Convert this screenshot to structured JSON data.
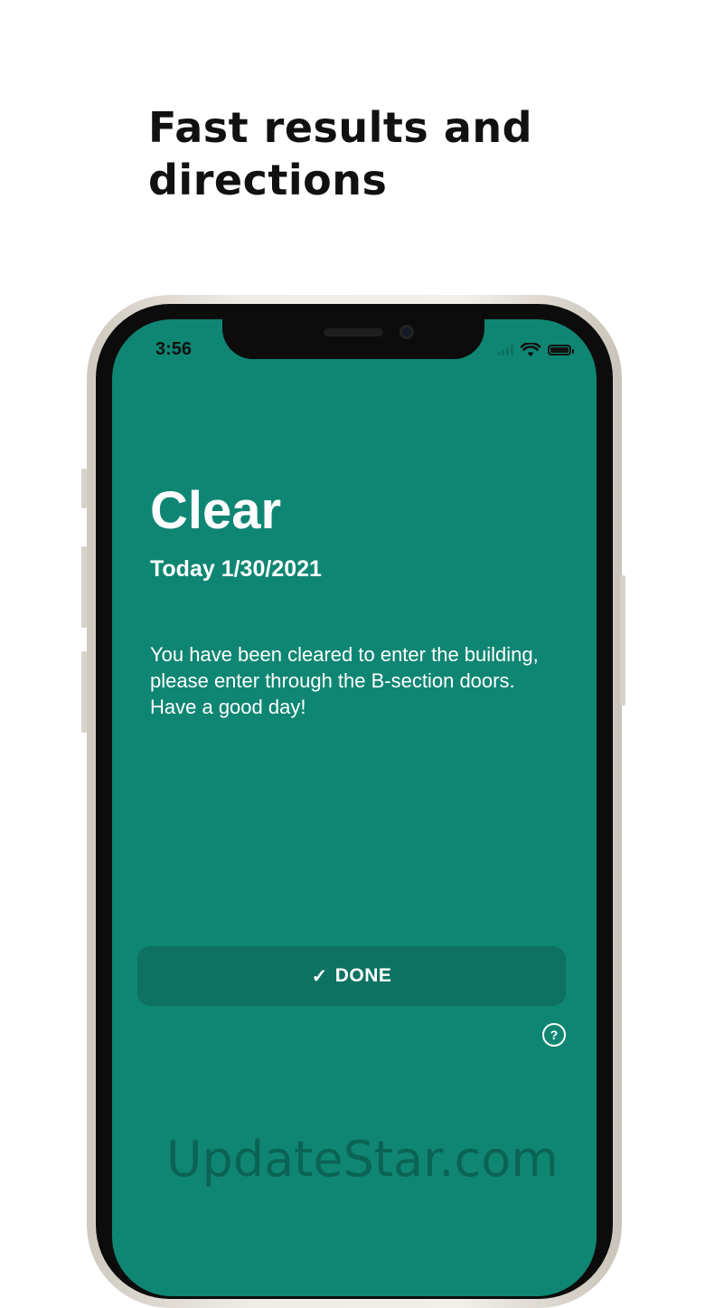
{
  "headline": {
    "line1": "Fast results and",
    "line2": "directions"
  },
  "status_bar": {
    "time": "3:56"
  },
  "screen": {
    "status_title": "Clear",
    "date": "Today 1/30/2021",
    "message": "You have been cleared to enter the building, please enter through the B-section doors. Have a good day!",
    "done_check": "✓",
    "done_label": "DONE",
    "help_glyph": "?"
  },
  "icons": [
    "wifi-icon",
    "battery-icon",
    "checkmark-icon",
    "help-icon"
  ],
  "colors": {
    "screen_bg": "#0f8673",
    "button_bg": "#0d7262",
    "text": "#ffffff"
  },
  "watermark": "UpdateStar.com"
}
